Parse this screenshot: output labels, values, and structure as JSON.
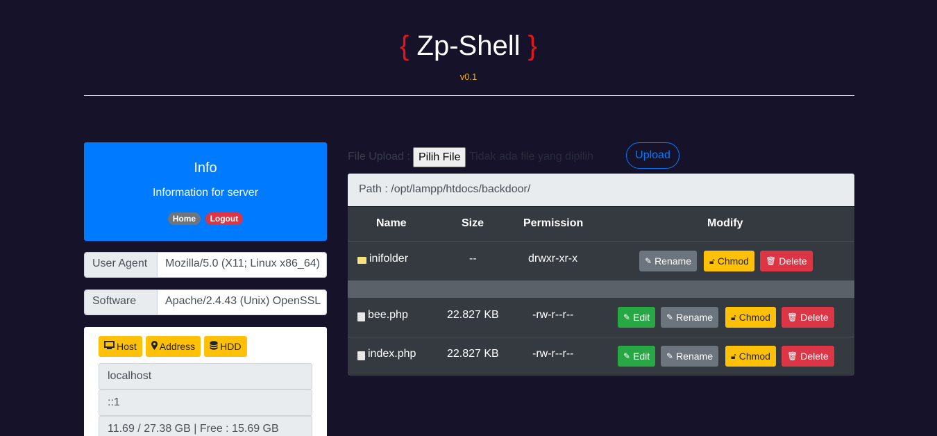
{
  "header": {
    "brace_open": "{",
    "title": "Zp-Shell",
    "brace_close": "}",
    "version": "v0.1"
  },
  "info": {
    "title": "Info",
    "subtitle": "Information for server",
    "home": "Home",
    "logout": "Logout"
  },
  "user_agent": {
    "label": "User Agent",
    "value": "Mozilla/5.0 (X11; Linux x86_64)"
  },
  "software": {
    "label": "Software",
    "value": "Apache/2.4.43 (Unix) OpenSSL"
  },
  "system": {
    "host_btn": "Host",
    "address_btn": "Address",
    "hdd_btn": "HDD",
    "host": "localhost",
    "address": "::1",
    "hdd": "11.69 / 27.38 GB | Free : 15.69 GB"
  },
  "upload": {
    "label": "File Upload :",
    "choose": "Pilih File",
    "none": "Tidak ada file yang dipilih",
    "submit": "Upload"
  },
  "path": "Path : /opt/lampp/htdocs/backdoor/",
  "table": {
    "headers": {
      "name": "Name",
      "size": "Size",
      "permission": "Permission",
      "modify": "Modify"
    },
    "rows": [
      {
        "name": "inifolder",
        "size": "--",
        "permission": "drwxr-xr-x",
        "type": "folder"
      },
      {
        "name": "bee.php",
        "size": "22.827 KB",
        "permission": "-rw-r--r--",
        "type": "file"
      },
      {
        "name": "index.php",
        "size": "22.827 KB",
        "permission": "-rw-r--r--",
        "type": "file"
      }
    ],
    "actions": {
      "edit": "Edit",
      "rename": "Rename",
      "chmod": "Chmod",
      "delete": "Delete"
    }
  }
}
